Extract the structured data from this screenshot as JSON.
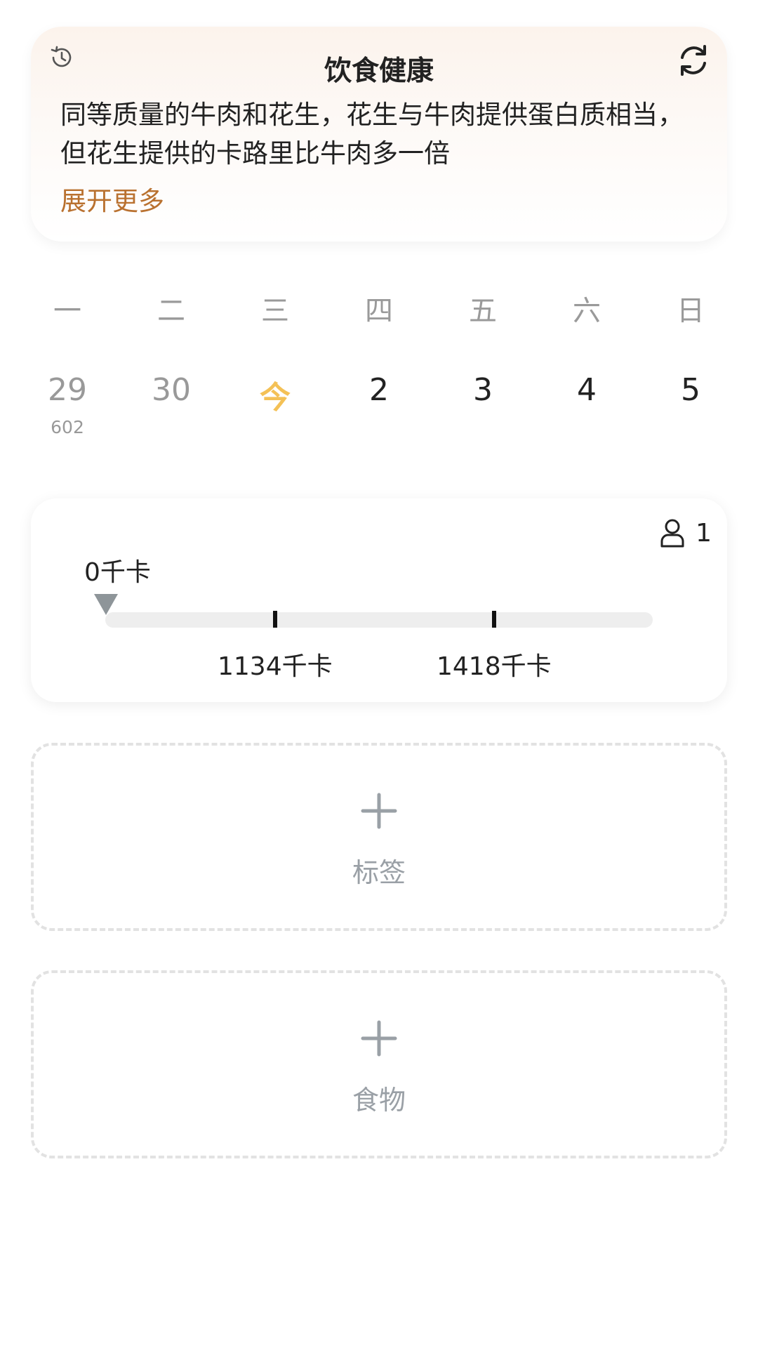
{
  "tip": {
    "title": "饮食健康",
    "text": "同等质量的牛肉和花生，花生与牛肉提供蛋白质相当，但花生提供的卡路里比牛肉多一倍",
    "more": "展开更多",
    "icons": {
      "history": "history-icon",
      "refresh": "refresh-icon"
    }
  },
  "week": {
    "days": [
      "一",
      "二",
      "三",
      "四",
      "五",
      "六",
      "日"
    ],
    "dates": [
      {
        "label": "29",
        "sub": "602",
        "state": "past"
      },
      {
        "label": "30",
        "sub": "",
        "state": "past"
      },
      {
        "label": "今",
        "sub": "",
        "state": "today"
      },
      {
        "label": "2",
        "sub": "",
        "state": "future"
      },
      {
        "label": "3",
        "sub": "",
        "state": "future"
      },
      {
        "label": "4",
        "sub": "",
        "state": "future"
      },
      {
        "label": "5",
        "sub": "",
        "state": "future"
      }
    ]
  },
  "calories": {
    "current": "0千卡",
    "person_count": "1",
    "progress": 0,
    "ticks": [
      {
        "label": "1134千卡",
        "fraction": 0.31
      },
      {
        "label": "1418千卡",
        "fraction": 0.71
      }
    ]
  },
  "add": {
    "tag_label": "标签",
    "food_label": "食物"
  },
  "colors": {
    "accent": "#b9712f",
    "today": "#f4c156",
    "pointer": "#8e9599",
    "dashed": "#e2e2e2"
  }
}
